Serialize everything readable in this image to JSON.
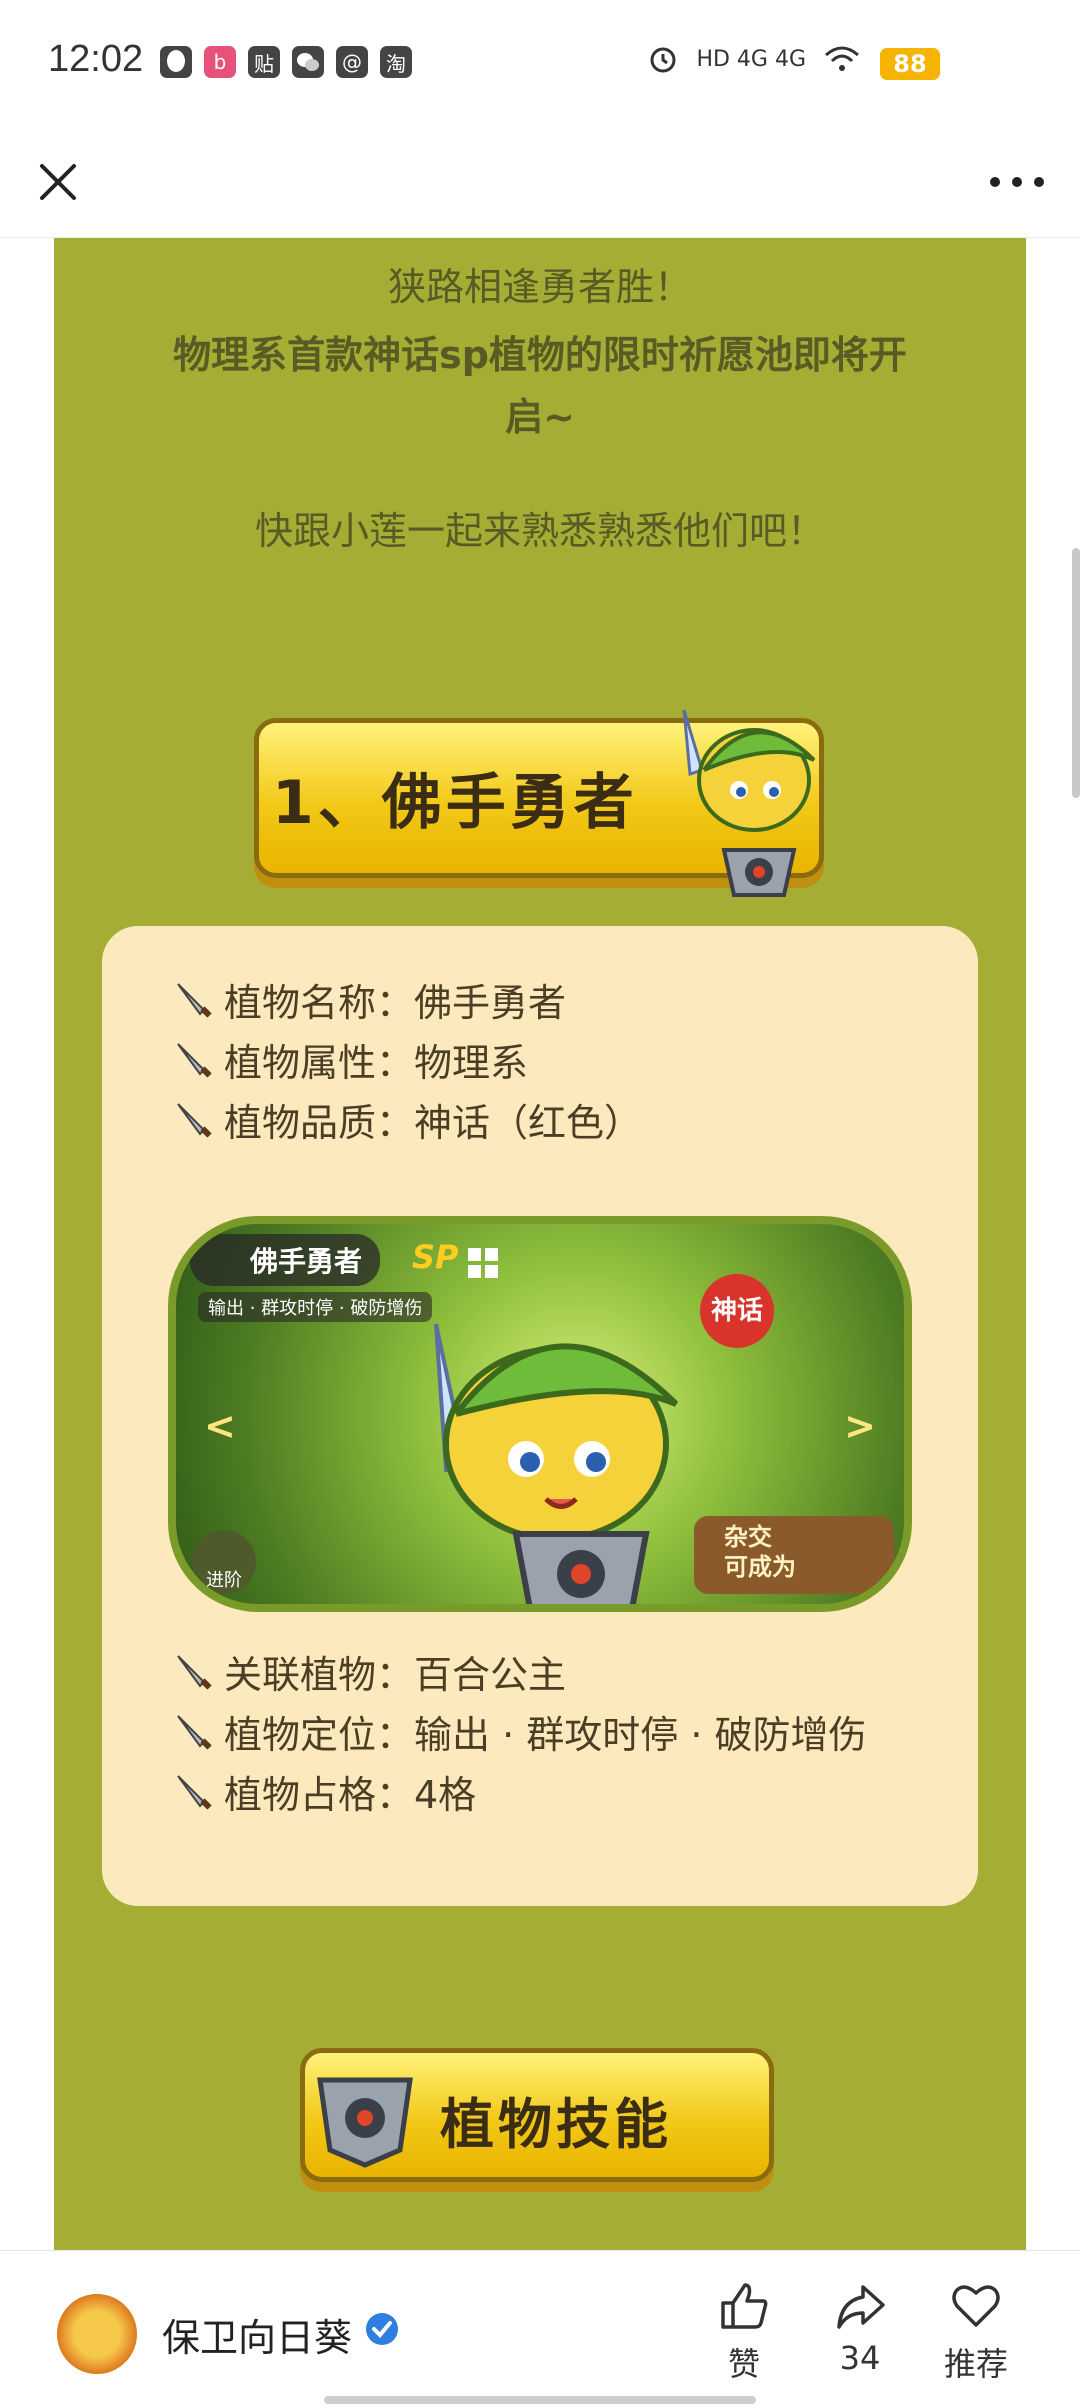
{
  "status_bar": {
    "time": "12:02",
    "apps": [
      "QQ",
      "bilibili",
      "贴",
      "微信",
      "@",
      "淘"
    ],
    "signal": "HD 4G 4G",
    "battery": "88"
  },
  "topbar": {
    "close_icon": "close-icon",
    "more_icon": "more-dots-icon"
  },
  "article": {
    "line1": "狭路相逢勇者胜！",
    "line2": "物理系首款神话sp植物的限时祈愿池即将开",
    "line3": "启~",
    "line4": "快跟小莲一起来熟悉熟悉他们吧！",
    "banner1": "1、佛手勇者",
    "info": [
      "植物名称：佛手勇者",
      "植物属性：物理系",
      "植物品质：神话（红色）"
    ],
    "game_shot": {
      "name": "佛手勇者",
      "sp": "SP",
      "tags": "输出 · 群攻时停 · 破防增伤",
      "myth": "神话",
      "advance": "进阶",
      "hybrid": "杂交\n可成为"
    },
    "info2": [
      "关联植物：百合公主",
      "植物定位：输出 · 群攻时停 · 破防增伤",
      "植物占格：4格"
    ],
    "banner2": "植物技能"
  },
  "bottom_bar": {
    "author": "保卫向日葵",
    "like_label": "赞",
    "share_count": "34",
    "recommend_label": "推荐"
  },
  "colors": {
    "content_bg": "#a5ad35",
    "card_bg": "#fde9be",
    "banner_yellow": "#f2c817",
    "text_dark": "#5a5a24"
  }
}
